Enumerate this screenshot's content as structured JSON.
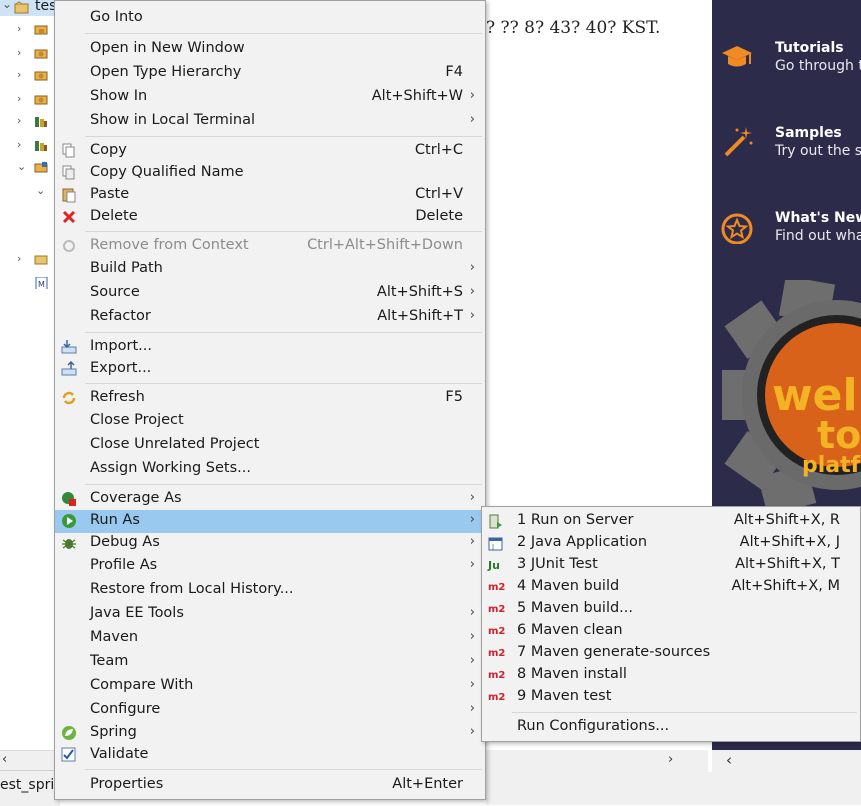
{
  "explorer": {
    "root_label": "tes",
    "status_text": "est_sprin"
  },
  "editor": {
    "text": "? ?? 8? 43? 40? KST."
  },
  "welcome": {
    "items": [
      {
        "title": "Tutorials",
        "desc": "Go through tu",
        "icon": "graduation-cap-icon"
      },
      {
        "title": "Samples",
        "desc": "Try out the sa",
        "icon": "magic-wand-icon"
      },
      {
        "title": "What's New",
        "desc": "Find out wha",
        "icon": "star-icon"
      }
    ],
    "banner_text": [
      "wel",
      "to",
      "platf"
    ]
  },
  "context_menu": {
    "go_into": "Go Into",
    "open_new_window": "Open in New Window",
    "open_type_hierarchy": "Open Type Hierarchy",
    "open_type_hierarchy_acc": "F4",
    "show_in": "Show In",
    "show_in_acc": "Alt+Shift+W",
    "show_local_terminal": "Show in Local Terminal",
    "copy": "Copy",
    "copy_acc": "Ctrl+C",
    "copy_qualified": "Copy Qualified Name",
    "paste": "Paste",
    "paste_acc": "Ctrl+V",
    "delete": "Delete",
    "delete_acc": "Delete",
    "remove_context": "Remove from Context",
    "remove_context_acc": "Ctrl+Alt+Shift+Down",
    "build_path": "Build Path",
    "source": "Source",
    "source_acc": "Alt+Shift+S",
    "refactor": "Refactor",
    "refactor_acc": "Alt+Shift+T",
    "import": "Import...",
    "export": "Export...",
    "refresh": "Refresh",
    "refresh_acc": "F5",
    "close_project": "Close Project",
    "close_unrelated": "Close Unrelated Project",
    "assign_working_sets": "Assign Working Sets...",
    "coverage_as": "Coverage As",
    "run_as": "Run As",
    "debug_as": "Debug As",
    "profile_as": "Profile As",
    "restore_history": "Restore from Local History...",
    "java_ee_tools": "Java EE Tools",
    "maven": "Maven",
    "team": "Team",
    "compare_with": "Compare With",
    "configure": "Configure",
    "spring": "Spring",
    "validate": "Validate",
    "properties": "Properties",
    "properties_acc": "Alt+Enter"
  },
  "run_as_submenu": {
    "items": [
      {
        "label": "1 Run on Server",
        "acc": "Alt+Shift+X, R",
        "icon": "server-icon"
      },
      {
        "label": "2 Java Application",
        "acc": "Alt+Shift+X, J",
        "icon": "java-app-icon"
      },
      {
        "label": "3 JUnit Test",
        "acc": "Alt+Shift+X, T",
        "icon": "junit-icon"
      },
      {
        "label": "4 Maven build",
        "acc": "Alt+Shift+X, M",
        "icon": "m2-icon"
      },
      {
        "label": "5 Maven build...",
        "acc": "",
        "icon": "m2-icon"
      },
      {
        "label": "6 Maven clean",
        "acc": "",
        "icon": "m2-icon"
      },
      {
        "label": "7 Maven generate-sources",
        "acc": "",
        "icon": "m2-icon"
      },
      {
        "label": "8 Maven install",
        "acc": "",
        "icon": "m2-icon"
      },
      {
        "label": "9 Maven test",
        "acc": "",
        "icon": "m2-icon"
      }
    ],
    "run_configurations": "Run Configurations...",
    "m2_text": "m2",
    "junit_text": "Ju"
  }
}
